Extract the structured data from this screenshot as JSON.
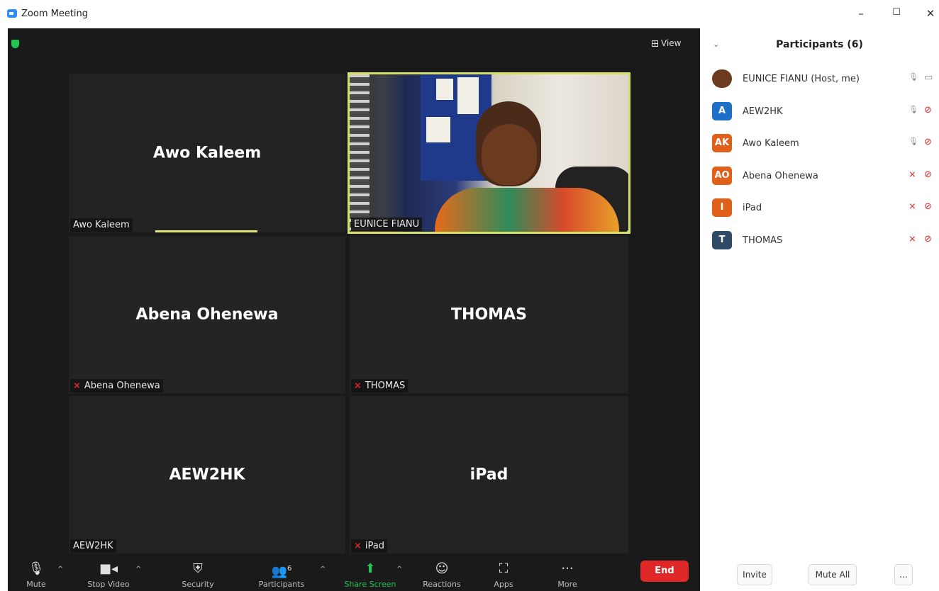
{
  "window": {
    "title": "Zoom Meeting",
    "minimize": "–",
    "maximize": "☐",
    "close": "✕"
  },
  "meeting": {
    "view_label": "View",
    "tiles": [
      {
        "big_name": "Awo Kaleem",
        "label": "Awo Kaleem",
        "muted": false
      },
      {
        "big_name": "",
        "label": "EUNICE FIANU",
        "muted": false,
        "video": true
      },
      {
        "big_name": "Abena Ohenewa",
        "label": "Abena Ohenewa",
        "muted": true
      },
      {
        "big_name": "THOMAS",
        "label": "THOMAS",
        "muted": true
      },
      {
        "big_name": "AEW2HK",
        "label": "AEW2HK",
        "muted": false
      },
      {
        "big_name": "iPad",
        "label": "iPad",
        "muted": true
      }
    ]
  },
  "toolbar": {
    "mute": "Mute",
    "stop_video": "Stop Video",
    "security": "Security",
    "participants": "Participants",
    "participants_count": "6",
    "share_screen": "Share Screen",
    "reactions": "Reactions",
    "apps": "Apps",
    "more": "More",
    "end": "End"
  },
  "panel": {
    "title": "Participants (6)",
    "participants": [
      {
        "initials": "",
        "name": "EUNICE FIANU (Host, me)",
        "color": "#6b3a1f",
        "mic_muted": false,
        "cam_off": false
      },
      {
        "initials": "A",
        "name": "AEW2HK",
        "color": "#1f6fc9",
        "mic_muted": false,
        "cam_off": true
      },
      {
        "initials": "AK",
        "name": "Awo Kaleem",
        "color": "#e0601a",
        "mic_muted": false,
        "cam_off": true
      },
      {
        "initials": "AO",
        "name": "Abena Ohenewa",
        "color": "#e0601a",
        "mic_muted": true,
        "cam_off": true
      },
      {
        "initials": "I",
        "name": "iPad",
        "color": "#e0601a",
        "mic_muted": true,
        "cam_off": true
      },
      {
        "initials": "T",
        "name": "THOMAS",
        "color": "#2e4a66",
        "mic_muted": true,
        "cam_off": true
      }
    ],
    "invite": "Invite",
    "mute_all": "Mute All",
    "more": "..."
  },
  "colors": {
    "accent_green": "#23c552",
    "end_red": "#e02828",
    "active_speaker": "#d6df6a"
  }
}
